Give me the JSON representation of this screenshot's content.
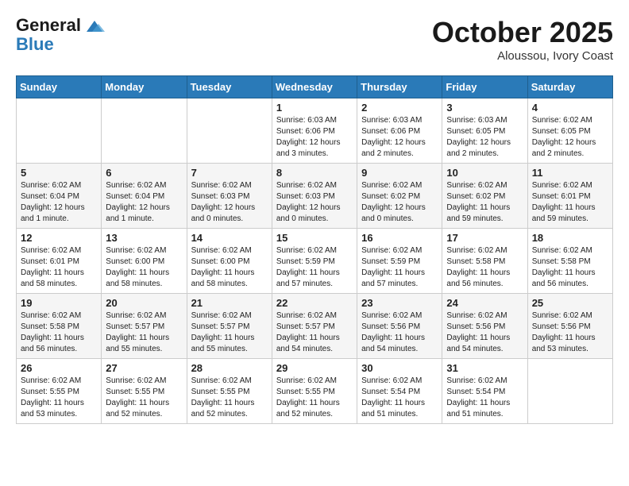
{
  "logo": {
    "line1": "General",
    "line2": "Blue"
  },
  "title": "October 2025",
  "subtitle": "Aloussou, Ivory Coast",
  "days": [
    "Sunday",
    "Monday",
    "Tuesday",
    "Wednesday",
    "Thursday",
    "Friday",
    "Saturday"
  ],
  "weeks": [
    [
      {
        "num": "",
        "info": ""
      },
      {
        "num": "",
        "info": ""
      },
      {
        "num": "",
        "info": ""
      },
      {
        "num": "1",
        "info": "Sunrise: 6:03 AM\nSunset: 6:06 PM\nDaylight: 12 hours and 3 minutes."
      },
      {
        "num": "2",
        "info": "Sunrise: 6:03 AM\nSunset: 6:06 PM\nDaylight: 12 hours and 2 minutes."
      },
      {
        "num": "3",
        "info": "Sunrise: 6:03 AM\nSunset: 6:05 PM\nDaylight: 12 hours and 2 minutes."
      },
      {
        "num": "4",
        "info": "Sunrise: 6:02 AM\nSunset: 6:05 PM\nDaylight: 12 hours and 2 minutes."
      }
    ],
    [
      {
        "num": "5",
        "info": "Sunrise: 6:02 AM\nSunset: 6:04 PM\nDaylight: 12 hours and 1 minute."
      },
      {
        "num": "6",
        "info": "Sunrise: 6:02 AM\nSunset: 6:04 PM\nDaylight: 12 hours and 1 minute."
      },
      {
        "num": "7",
        "info": "Sunrise: 6:02 AM\nSunset: 6:03 PM\nDaylight: 12 hours and 0 minutes."
      },
      {
        "num": "8",
        "info": "Sunrise: 6:02 AM\nSunset: 6:03 PM\nDaylight: 12 hours and 0 minutes."
      },
      {
        "num": "9",
        "info": "Sunrise: 6:02 AM\nSunset: 6:02 PM\nDaylight: 12 hours and 0 minutes."
      },
      {
        "num": "10",
        "info": "Sunrise: 6:02 AM\nSunset: 6:02 PM\nDaylight: 11 hours and 59 minutes."
      },
      {
        "num": "11",
        "info": "Sunrise: 6:02 AM\nSunset: 6:01 PM\nDaylight: 11 hours and 59 minutes."
      }
    ],
    [
      {
        "num": "12",
        "info": "Sunrise: 6:02 AM\nSunset: 6:01 PM\nDaylight: 11 hours and 58 minutes."
      },
      {
        "num": "13",
        "info": "Sunrise: 6:02 AM\nSunset: 6:00 PM\nDaylight: 11 hours and 58 minutes."
      },
      {
        "num": "14",
        "info": "Sunrise: 6:02 AM\nSunset: 6:00 PM\nDaylight: 11 hours and 58 minutes."
      },
      {
        "num": "15",
        "info": "Sunrise: 6:02 AM\nSunset: 5:59 PM\nDaylight: 11 hours and 57 minutes."
      },
      {
        "num": "16",
        "info": "Sunrise: 6:02 AM\nSunset: 5:59 PM\nDaylight: 11 hours and 57 minutes."
      },
      {
        "num": "17",
        "info": "Sunrise: 6:02 AM\nSunset: 5:58 PM\nDaylight: 11 hours and 56 minutes."
      },
      {
        "num": "18",
        "info": "Sunrise: 6:02 AM\nSunset: 5:58 PM\nDaylight: 11 hours and 56 minutes."
      }
    ],
    [
      {
        "num": "19",
        "info": "Sunrise: 6:02 AM\nSunset: 5:58 PM\nDaylight: 11 hours and 56 minutes."
      },
      {
        "num": "20",
        "info": "Sunrise: 6:02 AM\nSunset: 5:57 PM\nDaylight: 11 hours and 55 minutes."
      },
      {
        "num": "21",
        "info": "Sunrise: 6:02 AM\nSunset: 5:57 PM\nDaylight: 11 hours and 55 minutes."
      },
      {
        "num": "22",
        "info": "Sunrise: 6:02 AM\nSunset: 5:57 PM\nDaylight: 11 hours and 54 minutes."
      },
      {
        "num": "23",
        "info": "Sunrise: 6:02 AM\nSunset: 5:56 PM\nDaylight: 11 hours and 54 minutes."
      },
      {
        "num": "24",
        "info": "Sunrise: 6:02 AM\nSunset: 5:56 PM\nDaylight: 11 hours and 54 minutes."
      },
      {
        "num": "25",
        "info": "Sunrise: 6:02 AM\nSunset: 5:56 PM\nDaylight: 11 hours and 53 minutes."
      }
    ],
    [
      {
        "num": "26",
        "info": "Sunrise: 6:02 AM\nSunset: 5:55 PM\nDaylight: 11 hours and 53 minutes."
      },
      {
        "num": "27",
        "info": "Sunrise: 6:02 AM\nSunset: 5:55 PM\nDaylight: 11 hours and 52 minutes."
      },
      {
        "num": "28",
        "info": "Sunrise: 6:02 AM\nSunset: 5:55 PM\nDaylight: 11 hours and 52 minutes."
      },
      {
        "num": "29",
        "info": "Sunrise: 6:02 AM\nSunset: 5:55 PM\nDaylight: 11 hours and 52 minutes."
      },
      {
        "num": "30",
        "info": "Sunrise: 6:02 AM\nSunset: 5:54 PM\nDaylight: 11 hours and 51 minutes."
      },
      {
        "num": "31",
        "info": "Sunrise: 6:02 AM\nSunset: 5:54 PM\nDaylight: 11 hours and 51 minutes."
      },
      {
        "num": "",
        "info": ""
      }
    ]
  ]
}
